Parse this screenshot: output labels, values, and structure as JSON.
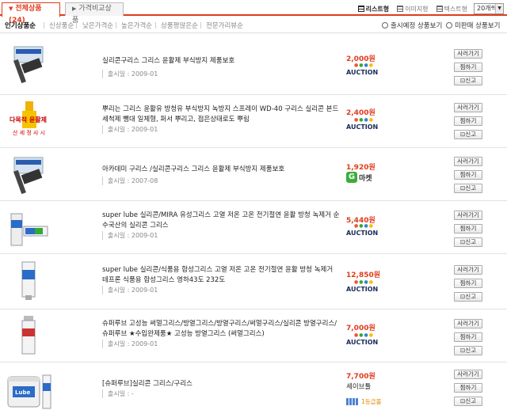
{
  "tabs": {
    "all_label": "전체상품",
    "all_count": "(24)",
    "compare_label": "가격비교상품"
  },
  "view_modes": {
    "list": "리스트형",
    "image": "이미지형",
    "text": "텍스트형",
    "per_page": "20개씩"
  },
  "sort": {
    "popular": "인기상품순",
    "newest": "신상품순",
    "low_price": "낮은가격순",
    "high_price": "높은가격순",
    "rating": "상품평많은순",
    "expert": "전문가리뷰순"
  },
  "filters": {
    "upcoming": "출시예정 상품보기",
    "unreleased": "미판매 상품보기"
  },
  "buttons": {
    "buy": "사러가기",
    "wish": "찜하기",
    "report": "신고"
  },
  "colors": {
    "accent": "#e03b1b",
    "gmarket_green": "#3cad3c"
  },
  "products": [
    {
      "title": "실리콘구리스 그리스 윤활제 부식방지 제품보호",
      "date": "출시일 : 2009-01",
      "price": "2,000원",
      "shop": "AUCTION",
      "shop_type": "auction"
    },
    {
      "title": "뿌리는 그리스 윤활유 방청유 부식방지 녹방지 스프레이 WD-40 구리스 실리콘 본드 세척제 뺑대 일체형, 퍼서 뿌리고, 접은상태로도 뿌림",
      "date": "출시일 : 2009-01",
      "price": "2,400원",
      "shop": "AUCTION",
      "shop_type": "auction"
    },
    {
      "title": "아카데미 구리스 /실리콘구리스 그리스 윤활제 부식방지 제품보호",
      "date": "출시일 : 2007-08",
      "price": "1,920원",
      "shop": "마켓",
      "shop_type": "gmarket"
    },
    {
      "title": "super lube 실리콘/MIRA 유성그리스 고열 저온 고온 전기절연 윤활 방청 녹제거 순수국산의 실리콘 그리스",
      "date": "출시일 : 2009-01",
      "price": "5,440원",
      "shop": "AUCTION",
      "shop_type": "auction"
    },
    {
      "title": "super lube 실리콘/식품용 합성그리스 고열 저온 고온 전기절연 윤활 방청 녹제거 테프론 식품용 합성그리스 영하43도 232도",
      "date": "출시일 : 2009-01",
      "price": "12,850원",
      "shop": "AUCTION",
      "shop_type": "auction"
    },
    {
      "title": "슈퍼루브 고성능 써멀그리스/방열그리스/방열구리스/써멀구리스/실리콘 방열구리스/슈퍼루브 ★수입완제품★ 고성능 방열그리스 (써멀그리스)",
      "date": "출시일 : 2009-01",
      "price": "7,000원",
      "shop": "AUCTION",
      "shop_type": "auction"
    },
    {
      "title": "[슈퍼루브]실리콘 그리스/구리스",
      "date": "출시일 : -",
      "price": "7,700원",
      "shop": "세이브툴",
      "shop_type": "text",
      "grade": "1등급몰"
    }
  ]
}
